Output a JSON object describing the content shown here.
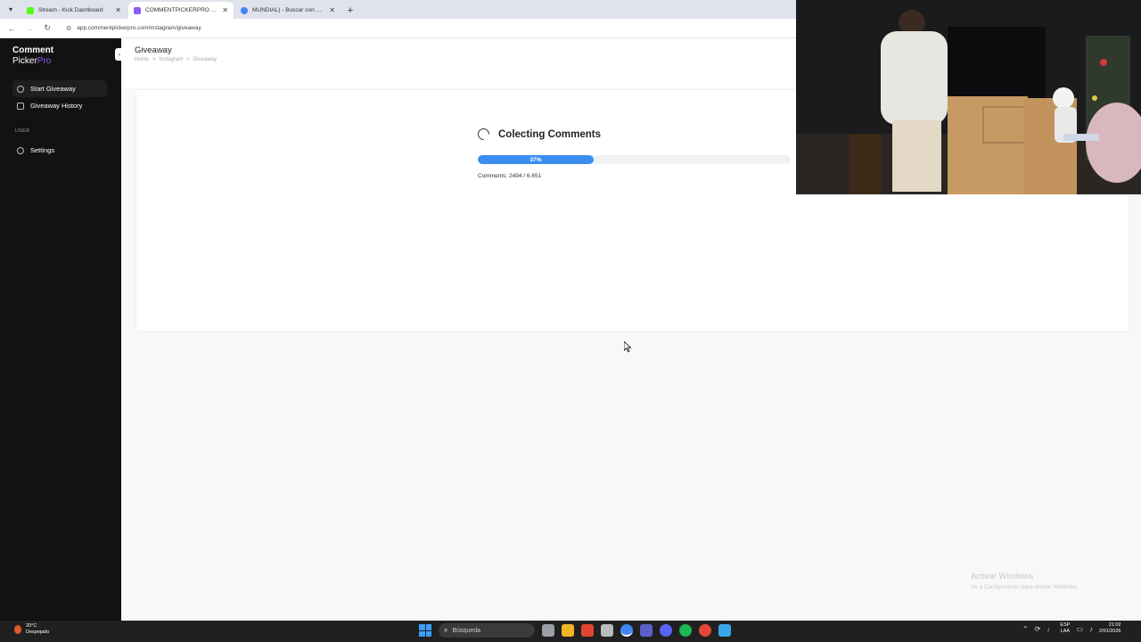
{
  "browser": {
    "tabs": [
      {
        "label": "Stream - Kick Dashboard",
        "active": false,
        "favicon_color": "#53fc18"
      },
      {
        "label": "COMMENTPICKERPRO - Dashb",
        "active": true,
        "favicon_color": "#8b5cf6"
      },
      {
        "label": "MUNDIAL) - Buscar con Google",
        "active": false,
        "favicon_color": "#4285f4"
      }
    ],
    "url": "app.commentpickerpro.com/instagram/giveaway"
  },
  "sidebar": {
    "logo_line1": "Comment",
    "logo_line2a": "Picker",
    "logo_line2b": "Pro",
    "items": [
      {
        "label": "Start Giveaway",
        "active": true
      },
      {
        "label": "Giveaway History",
        "active": false
      }
    ],
    "section_user": "USER",
    "settings_label": "Settings"
  },
  "page": {
    "title": "Giveaway",
    "breadcrumb": [
      "Home",
      ">",
      "Instagram",
      ">",
      "Giveaway"
    ]
  },
  "progress": {
    "title": "Colecting Comments",
    "percent": 37,
    "percent_label": "37%",
    "count_text": "Comments: 2494 / 6.651"
  },
  "watermark": {
    "line1": "Activar Windows",
    "line2": "Ve a Configuración para activar Windows."
  },
  "taskbar": {
    "weather_temp": "20°C",
    "weather_desc": "Despejado",
    "search_placeholder": "Búsqueda",
    "apps": [
      "#9aa0a6",
      "#f0b429",
      "#e0462f",
      "#bbbbbb",
      "#4285f4",
      "#5b5fc7",
      "#5865f2",
      "#1db954",
      "#e2463a",
      "#3aa8e8"
    ],
    "lang_line1": "ESP",
    "lang_line2": "LAA",
    "time": "21:02",
    "date": "2/01/2026"
  }
}
